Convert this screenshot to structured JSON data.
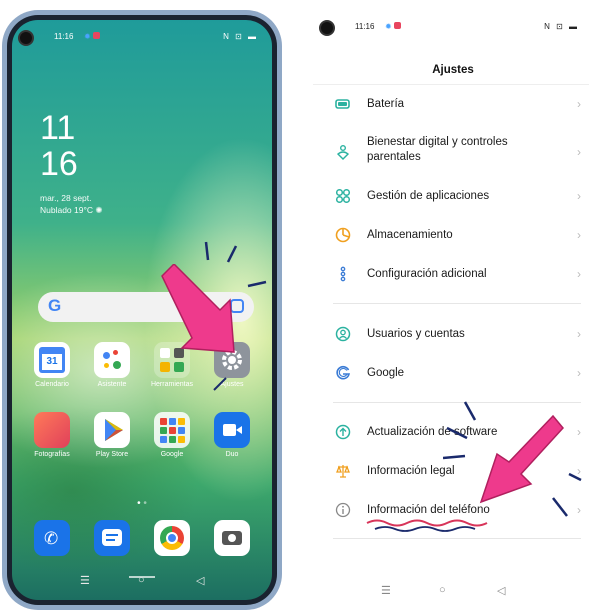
{
  "home": {
    "status_time": "11:16",
    "status_icons": "N ⊡ ▬",
    "clock_hour": "11",
    "clock_min": "16",
    "date": "mar., 28 sept.",
    "weather": "Nublado 19°C",
    "search_logo": "G",
    "apps": [
      {
        "label": "Calendario"
      },
      {
        "label": "Asistente"
      },
      {
        "label": "Herramientas"
      },
      {
        "label": "Ajustes"
      },
      {
        "label": "Fotografías"
      },
      {
        "label": "Play Store"
      },
      {
        "label": "Google"
      },
      {
        "label": "Duo"
      }
    ],
    "calendar_num": "31",
    "nav": {
      "menu": "☰",
      "home": "○",
      "back": "◁"
    }
  },
  "settings": {
    "status_time": "11:16",
    "status_icons": "N ⊡ ▬",
    "title": "Ajustes",
    "items": [
      {
        "label": "Batería",
        "icon": "battery-icon",
        "color": "#2bb2a0"
      },
      {
        "label": "Bienestar digital y controles parentales",
        "icon": "wellbeing-icon",
        "color": "#2bb2a0"
      },
      {
        "label": "Gestión de aplicaciones",
        "icon": "apps-grid-icon",
        "color": "#2bb2a0"
      },
      {
        "label": "Almacenamiento",
        "icon": "storage-pie-icon",
        "color": "#f0a020"
      },
      {
        "label": "Configuración adicional",
        "icon": "more-settings-icon",
        "color": "#3a7bd5"
      },
      {
        "label": "Usuarios y cuentas",
        "icon": "user-icon",
        "color": "#2bb2a0"
      },
      {
        "label": "Google",
        "icon": "google-icon",
        "color": "#3a7bd5"
      },
      {
        "label": "Actualización de software",
        "icon": "update-icon",
        "color": "#2bb2a0"
      },
      {
        "label": "Información legal",
        "icon": "legal-scale-icon",
        "color": "#f0a020"
      },
      {
        "label": "Información del teléfono",
        "icon": "info-icon",
        "color": "#888888"
      }
    ],
    "chevron": "›",
    "nav": {
      "menu": "☰",
      "home": "○",
      "back": "◁"
    }
  },
  "colors": {
    "annotation_pink": "#ee3a8c",
    "annotation_navy": "#1a2a6c",
    "underline_red": "#d8355a"
  }
}
